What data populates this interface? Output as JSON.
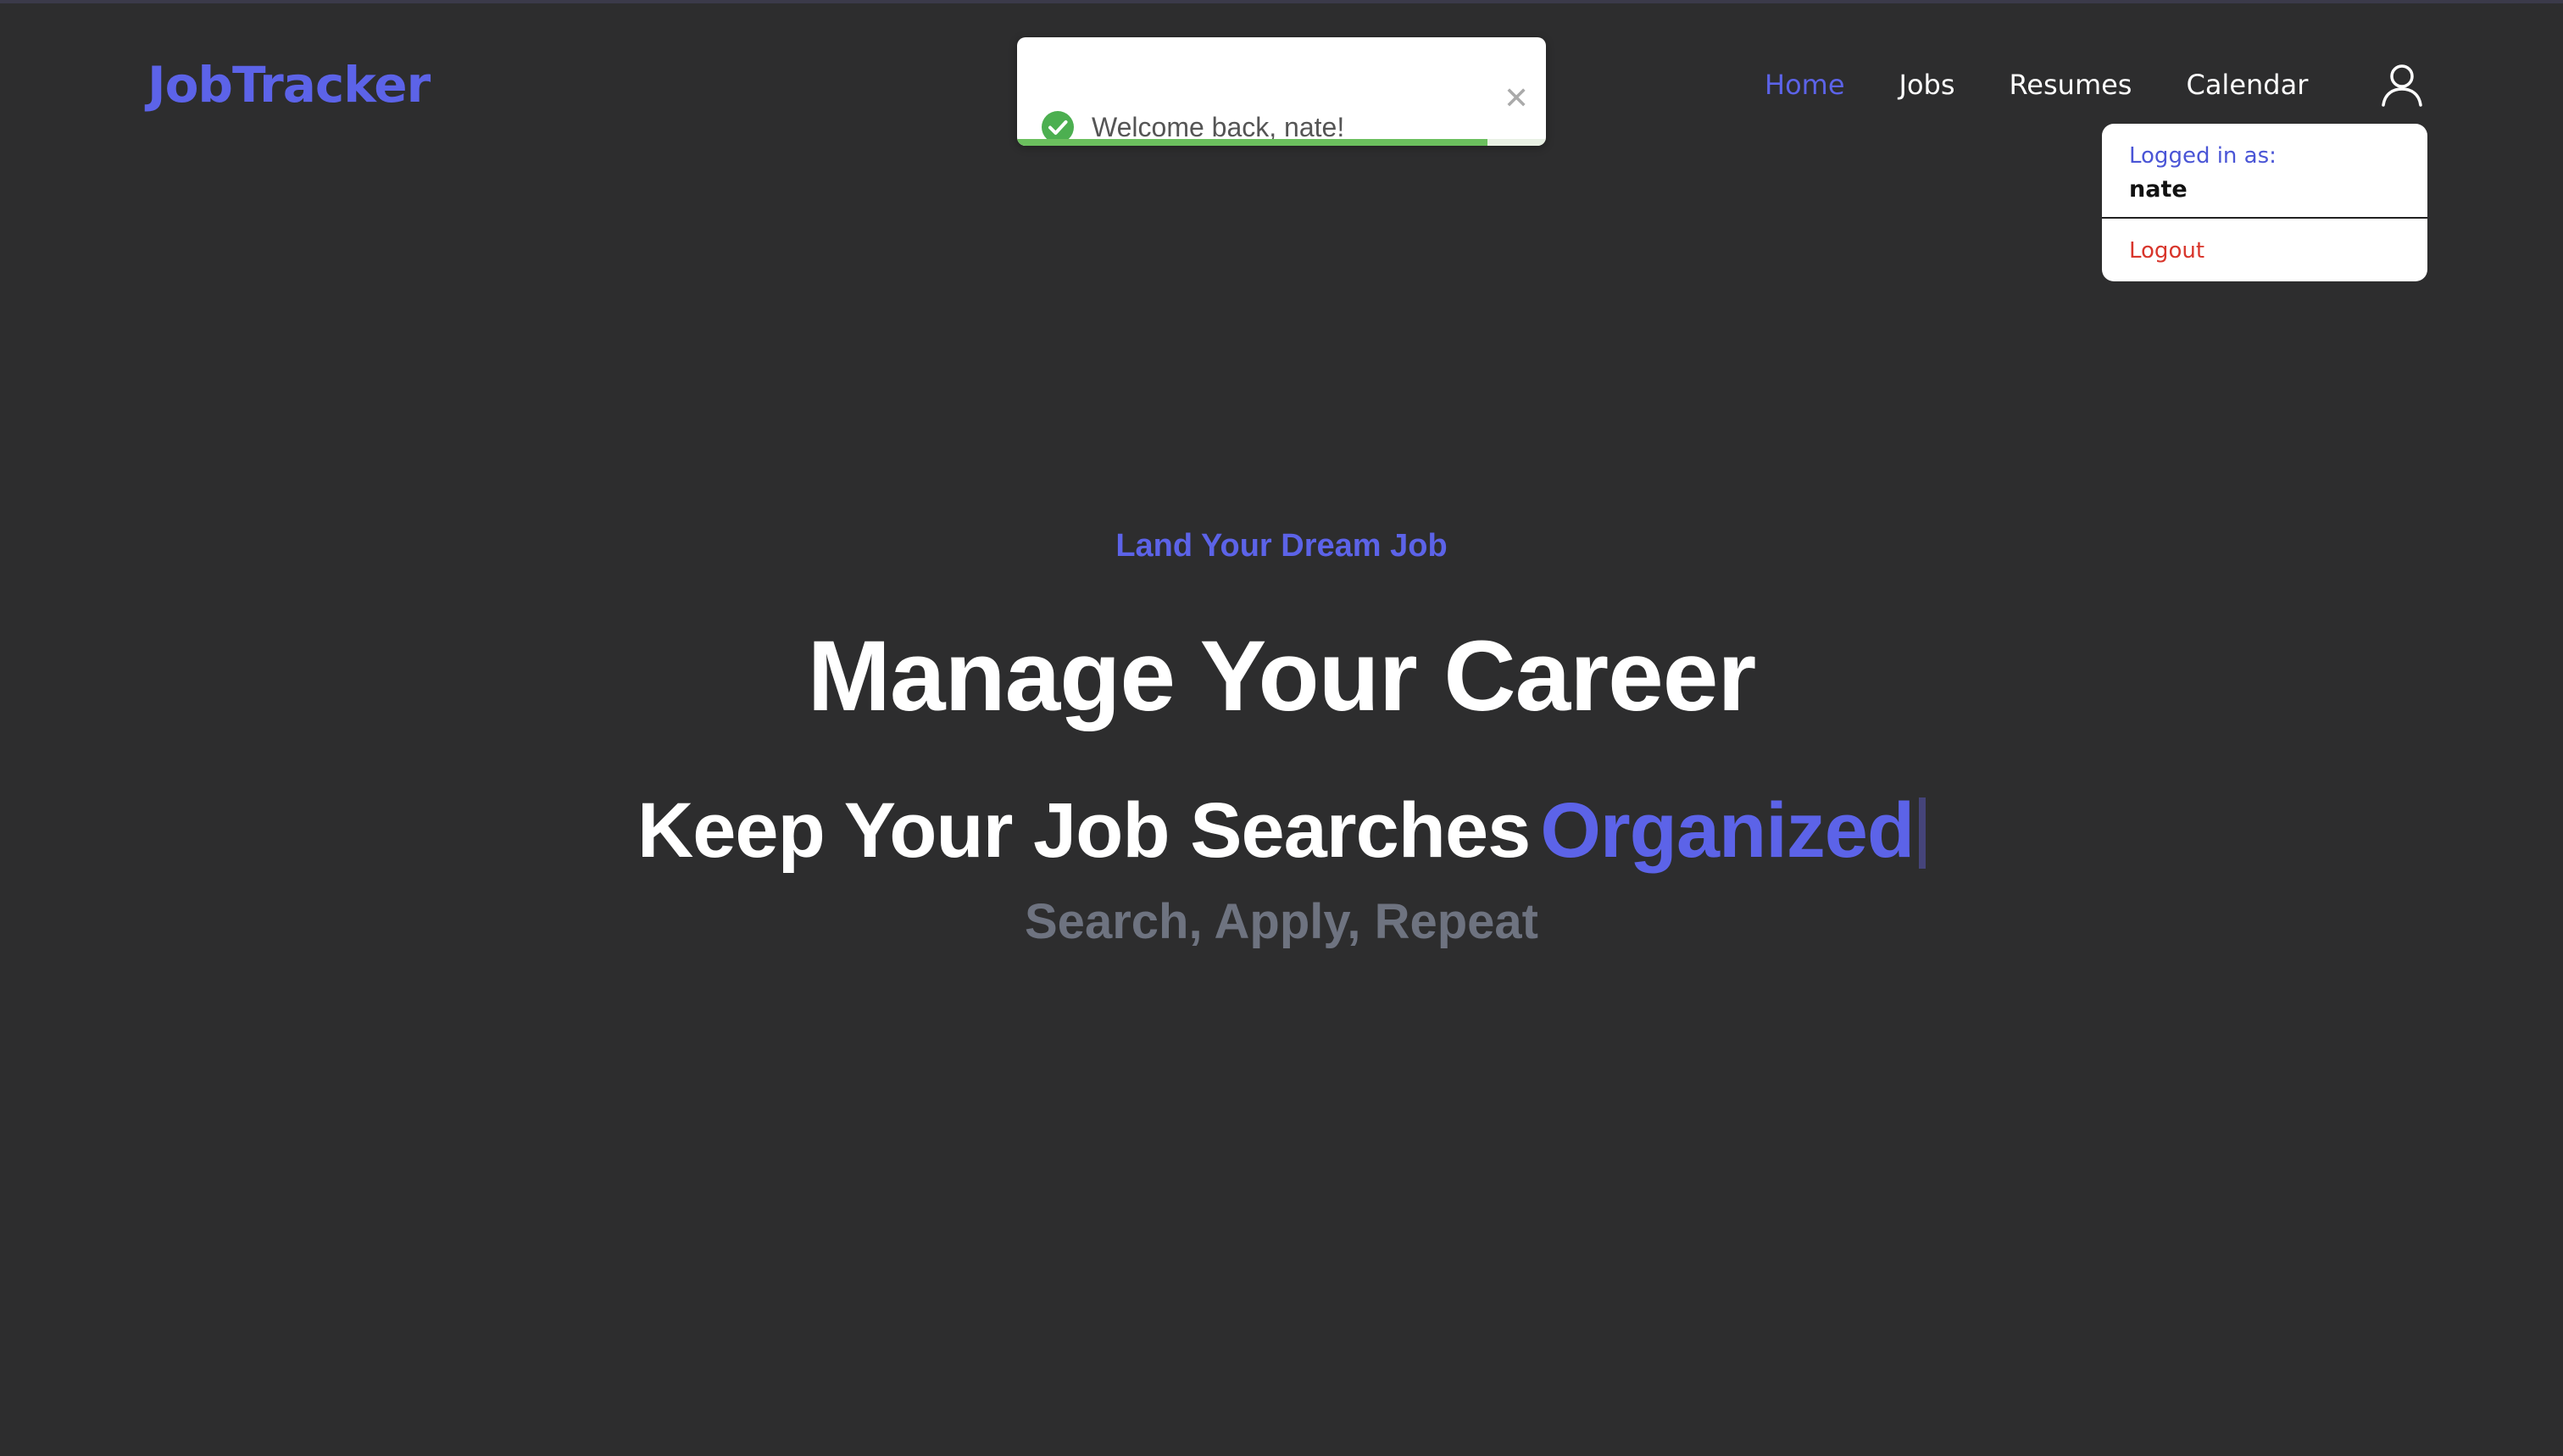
{
  "brand": {
    "name": "JobTracker",
    "color": "#5c63e8"
  },
  "nav": {
    "items": [
      {
        "label": "Home",
        "active": true
      },
      {
        "label": "Jobs",
        "active": false
      },
      {
        "label": "Resumes",
        "active": false
      },
      {
        "label": "Calendar",
        "active": false
      }
    ],
    "user_icon": "user-icon"
  },
  "toast": {
    "message": "Welcome back, nate!",
    "icon": "check-circle-icon",
    "close_icon": "close-icon",
    "progress_fraction": 0.89,
    "progress_color": "#6bbf5e"
  },
  "user_menu": {
    "label": "Logged in as:",
    "username": "nate",
    "logout_label": "Logout",
    "logout_color": "#d8352b"
  },
  "hero": {
    "eyebrow": "Land Your Dream Job",
    "headline": "Manage Your Career",
    "subheadline_static": "Keep Your Job Searches",
    "subheadline_rotating": "Organized",
    "tagline": "Search, Apply, Repeat"
  },
  "colors": {
    "background": "#2d2d2e",
    "accent": "#5c63e8",
    "muted_text": "#6e7380"
  }
}
